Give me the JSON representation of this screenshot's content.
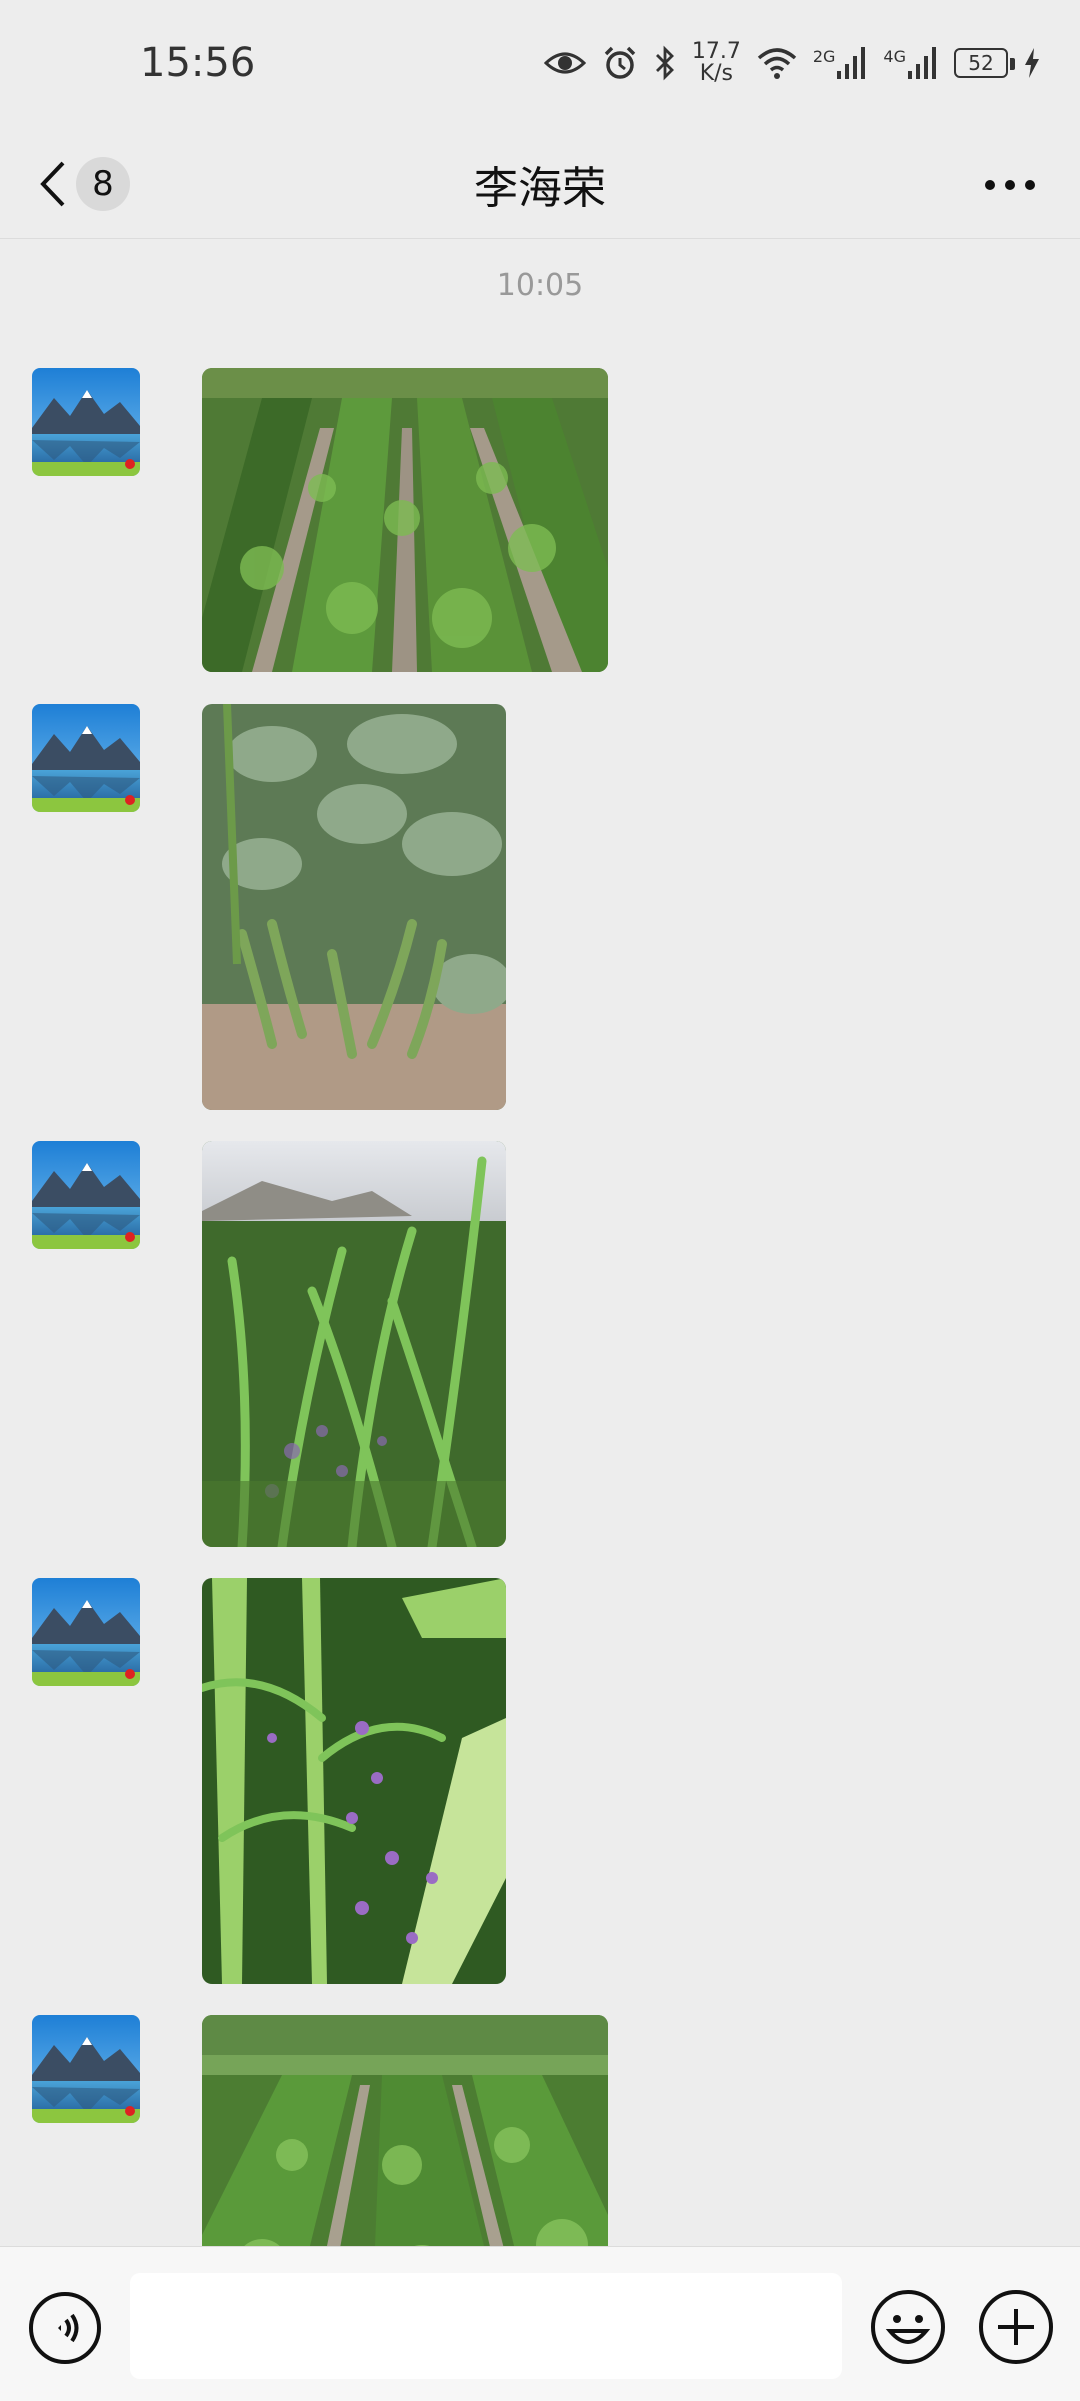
{
  "status_bar": {
    "time": "15:56",
    "net_speed_value": "17.7",
    "net_speed_unit": "K/s",
    "signal1_label": "2G",
    "signal2_label": "4G",
    "battery_level": "52"
  },
  "header": {
    "back_count": "8",
    "title": "李海荣"
  },
  "chat": {
    "timestamp": "10:05",
    "messages": [
      {
        "type": "image",
        "icon": "photo-bean-field-rows"
      },
      {
        "type": "image",
        "icon": "photo-broad-bean-pods"
      },
      {
        "type": "image",
        "icon": "photo-corn-and-vetch"
      },
      {
        "type": "image",
        "icon": "photo-corn-vetch-closeup"
      },
      {
        "type": "image",
        "icon": "photo-bean-field-rows-2"
      }
    ]
  },
  "input_bar": {
    "placeholder": ""
  }
}
